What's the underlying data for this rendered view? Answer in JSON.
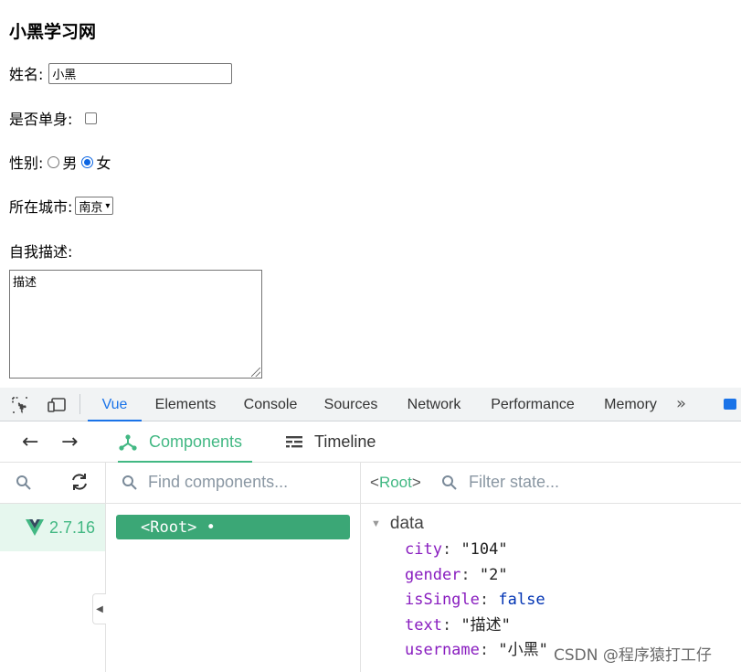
{
  "page": {
    "title": "小黑学习网",
    "name_label": "姓名:",
    "name_value": "小黑",
    "single_label": "是否单身:",
    "gender_label": "性别:",
    "gender_male": "男",
    "gender_female": "女",
    "gender_selected": "女",
    "city_label": "所在城市:",
    "city_value": "南京",
    "desc_label": "自我描述:",
    "desc_value": "描述"
  },
  "devtools": {
    "tabs": [
      "Vue",
      "Elements",
      "Console",
      "Sources",
      "Network",
      "Performance",
      "Memory"
    ],
    "active_tab": "Vue",
    "more_label": "»",
    "icons": {
      "inspect": "inspect-element-icon",
      "device": "device-toolbar-icon",
      "messages": "messages-icon"
    }
  },
  "vue": {
    "tabs": {
      "components": "Components",
      "timeline": "Timeline"
    },
    "app_version": "2.7.16",
    "find_placeholder": "Find components...",
    "root_node": "<Root> •",
    "selected_open": "<",
    "selected_name": "Root",
    "selected_close": ">",
    "filter_placeholder": "Filter state...",
    "section": "data",
    "state": [
      {
        "key": "city",
        "value": "\"104\"",
        "type": "string"
      },
      {
        "key": "gender",
        "value": "\"2\"",
        "type": "string"
      },
      {
        "key": "isSingle",
        "value": "false",
        "type": "boolean"
      },
      {
        "key": "text",
        "value": "\"描述\"",
        "type": "string"
      },
      {
        "key": "username",
        "value": "\"小黑\"",
        "type": "string"
      }
    ],
    "colors": {
      "accent": "#42b883",
      "root_bg": "#3ba776",
      "key": "#881cbf",
      "boolean": "#0033b3"
    }
  },
  "watermark": "CSDN @程序猿打工仔"
}
